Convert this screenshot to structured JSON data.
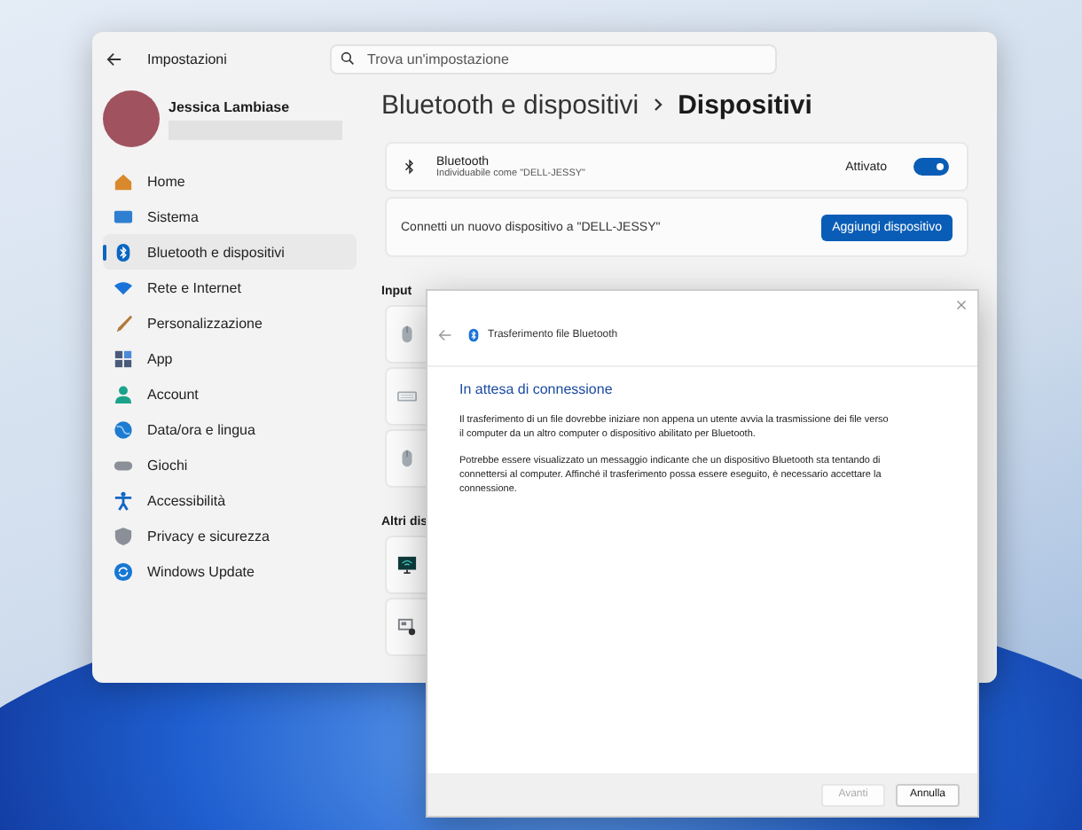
{
  "window": {
    "title": "Impostazioni"
  },
  "search": {
    "placeholder": "Trova un'impostazione"
  },
  "user": {
    "name": "Jessica Lambiase"
  },
  "sidebar": {
    "items": [
      {
        "label": "Home",
        "kind": "home",
        "selected": false
      },
      {
        "label": "Sistema",
        "kind": "system",
        "selected": false
      },
      {
        "label": "Bluetooth e dispositivi",
        "kind": "bluetooth",
        "selected": true
      },
      {
        "label": "Rete e Internet",
        "kind": "network",
        "selected": false
      },
      {
        "label": "Personalizzazione",
        "kind": "brush",
        "selected": false
      },
      {
        "label": "App",
        "kind": "apps",
        "selected": false
      },
      {
        "label": "Account",
        "kind": "account",
        "selected": false
      },
      {
        "label": "Data/ora e lingua",
        "kind": "globe",
        "selected": false
      },
      {
        "label": "Giochi",
        "kind": "gamepad",
        "selected": false
      },
      {
        "label": "Accessibilità",
        "kind": "accessibility",
        "selected": false
      },
      {
        "label": "Privacy e sicurezza",
        "kind": "shield",
        "selected": false
      },
      {
        "label": "Windows Update",
        "kind": "update",
        "selected": false
      }
    ]
  },
  "breadcrumb": [
    "Bluetooth e dispositivi",
    "Dispositivi"
  ],
  "bluetooth": {
    "title": "Bluetooth",
    "subtitle": "Individuabile come \"DELL-JESSY\"",
    "state_label": "Attivato",
    "on": true
  },
  "connect": {
    "text": "Connetti un nuovo dispositivo a \"DELL-JESSY\"",
    "button": "Aggiungi dispositivo"
  },
  "sections": [
    {
      "heading": "Input",
      "devices": [
        {
          "kind": "mouse"
        },
        {
          "kind": "keyboard"
        },
        {
          "kind": "mouse"
        }
      ]
    },
    {
      "heading": "Altri dis",
      "devices": [
        {
          "kind": "monitor"
        },
        {
          "kind": "display"
        }
      ]
    }
  ],
  "dialog": {
    "title": "Trasferimento file Bluetooth",
    "heading": "In attesa di connessione",
    "paragraphs": [
      "Il trasferimento di un file dovrebbe iniziare non appena un utente avvia la trasmissione dei file verso il computer da un altro computer o dispositivo abilitato per Bluetooth.",
      "Potrebbe essere visualizzato un messaggio indicante che un dispositivo Bluetooth sta tentando di connettersi al computer. Affinché il trasferimento possa essere eseguito, è necessario accettare la connessione."
    ],
    "buttons": [
      {
        "label": "Avanti",
        "disabled": true
      },
      {
        "label": "Annulla",
        "disabled": false
      }
    ]
  }
}
